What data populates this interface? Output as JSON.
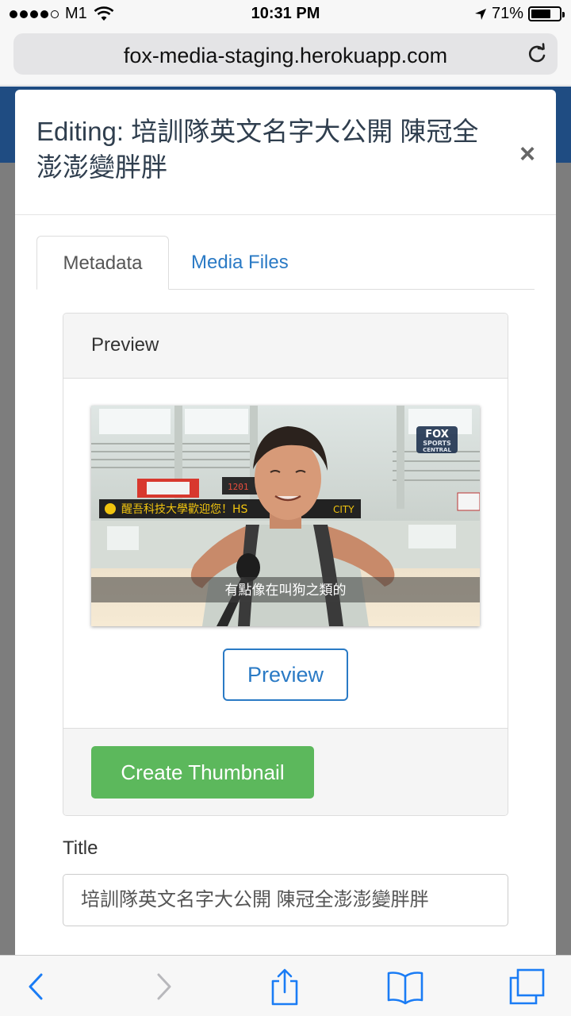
{
  "status_bar": {
    "carrier": "M1",
    "time": "10:31 PM",
    "battery": "71%",
    "battery_level": 0.71,
    "signal_bars_filled": 4,
    "signal_bars_total": 5
  },
  "browser": {
    "url": "fox-media-staging.herokuapp.com"
  },
  "modal": {
    "title": "Editing: 培訓隊英文名字大公開 陳冠全澎澎變胖胖",
    "close_label": "×",
    "tabs": [
      {
        "label": "Metadata",
        "active": true
      },
      {
        "label": "Media Files",
        "active": false
      }
    ],
    "preview_panel": {
      "heading": "Preview",
      "preview_button": "Preview",
      "create_thumbnail_button": "Create Thumbnail",
      "thumbnail": {
        "subtitle": "有點像在叫狗之類的",
        "logo_line1": "FOX",
        "logo_line2": "SPORTS",
        "logo_line3": "CENTRAL",
        "banner_text": "醒吾科技大學歡迎您！HS",
        "banner_tail": "CITY"
      }
    },
    "title_field": {
      "label": "Title",
      "value": "培訓隊英文名字大公開  陳冠全澎澎變胖胖"
    }
  },
  "colors": {
    "link_blue": "#2a7ac5",
    "success_green": "#5cb85c",
    "header_navy": "#1f4c82",
    "ios_blue": "#1a7cf5"
  },
  "toolbar_icons": [
    "back-icon",
    "forward-icon",
    "share-icon",
    "bookmarks-icon",
    "tabs-icon"
  ]
}
